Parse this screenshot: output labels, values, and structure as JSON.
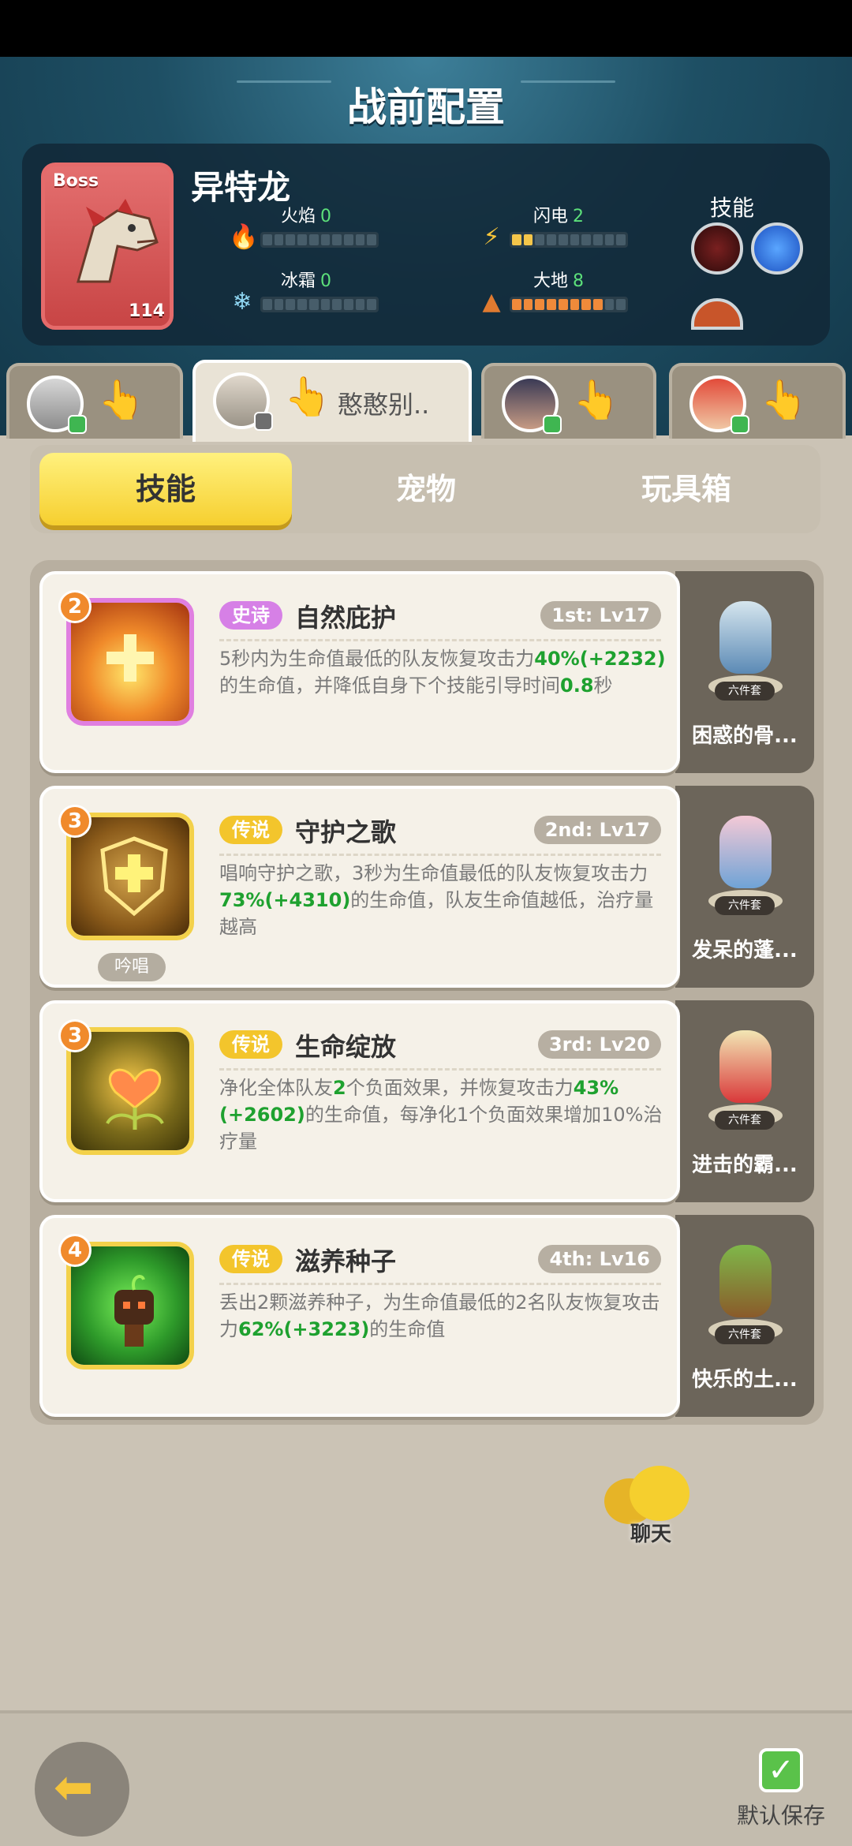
{
  "header": {
    "title": "战前配置"
  },
  "boss": {
    "tag": "Boss",
    "name": "异特龙",
    "level": "114",
    "skills_label": "技能",
    "elements": [
      {
        "label": "火焰",
        "value": "0",
        "icon": "fire-icon",
        "filled": 0
      },
      {
        "label": "闪电",
        "value": "2",
        "icon": "lightning-icon",
        "filled": 2
      },
      {
        "label": "冰霜",
        "value": "0",
        "icon": "snowflake-icon",
        "filled": 0
      },
      {
        "label": "大地",
        "value": "8",
        "icon": "earth-icon",
        "filled": 8
      }
    ]
  },
  "team": {
    "active_name": "憨憨别.."
  },
  "tabs": {
    "skills": "技能",
    "pets": "宠物",
    "toybox": "玩具箱"
  },
  "skills": [
    {
      "num": "2",
      "rarity": "史诗",
      "title": "自然庇护",
      "rank": "1st: Lv17",
      "desc": [
        "5秒内为生命值最低的队友恢复攻击力",
        "40%",
        "(+2232)",
        "的生命值，并降低自身下个技能引导时间",
        "0.8",
        "秒"
      ],
      "pet_name": "困惑的骨...",
      "pet_set": "六件套"
    },
    {
      "num": "3",
      "rarity": "传说",
      "title": "守护之歌",
      "rank": "2nd: Lv17",
      "chant": "吟唱",
      "desc": [
        "唱响守护之歌，3秒为生命值最低的队友恢复攻击力",
        "73%",
        "(+4310)",
        "的生命值，队友生命值越低，治疗量越高",
        "",
        ""
      ],
      "pet_name": "发呆的蓬...",
      "pet_set": "六件套"
    },
    {
      "num": "3",
      "rarity": "传说",
      "title": "生命绽放",
      "rank": "3rd: Lv20",
      "desc": [
        "净化全体队友",
        "2",
        "个负面效果，并恢复攻击力",
        "43%",
        "(+2602)",
        "的生命值，每净化1个负面效果增加10%治疗量"
      ],
      "pet_name": "进击的霸...",
      "pet_set": "六件套"
    },
    {
      "num": "4",
      "rarity": "传说",
      "title": "滋养种子",
      "rank": "4th: Lv16",
      "desc": [
        "丢出2颗滋养种子，为生命值最低的2名队友恢复攻击力",
        "62%",
        "(+3223)",
        "的生命值",
        "",
        ""
      ],
      "pet_name": "快乐的土...",
      "pet_set": "六件套"
    }
  ],
  "chat": {
    "label": "聊天"
  },
  "footer": {
    "save_label": "默认保存"
  },
  "colors": {
    "header_bg": "#1e4f64",
    "accent_yellow": "#f6cf2f",
    "highlight_green": "#1ea12f",
    "epic_purple": "#d680e6",
    "legend_gold": "#f3c52c"
  }
}
